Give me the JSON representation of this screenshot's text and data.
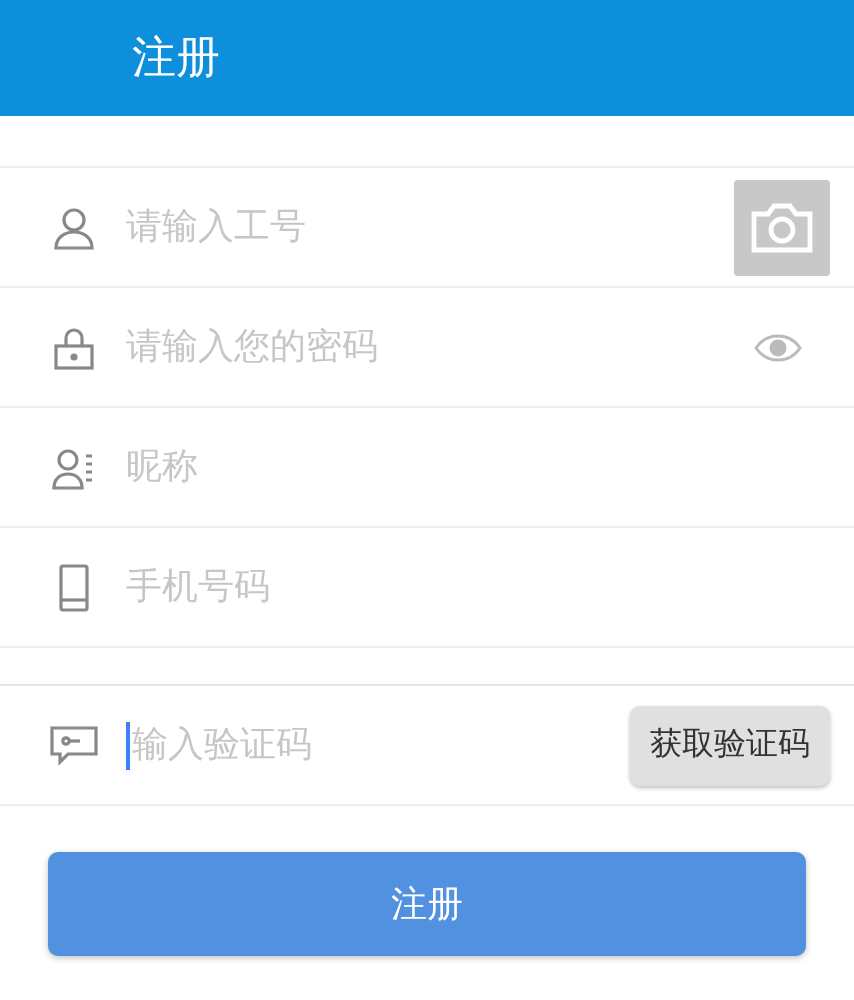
{
  "header": {
    "title": "注册"
  },
  "groups": [
    [
      {
        "kind": "userid",
        "placeholder": "请输入工号",
        "focused": false
      },
      {
        "kind": "password",
        "placeholder": "请输入您的密码",
        "focused": false
      },
      {
        "kind": "nickname",
        "placeholder": "昵称",
        "focused": false
      },
      {
        "kind": "phone",
        "placeholder": "手机号码",
        "focused": false
      }
    ],
    [
      {
        "kind": "code",
        "placeholder": "输入验证码",
        "button_label": "获取验证码",
        "focused": true
      }
    ]
  ],
  "submit": {
    "label": "注册"
  }
}
